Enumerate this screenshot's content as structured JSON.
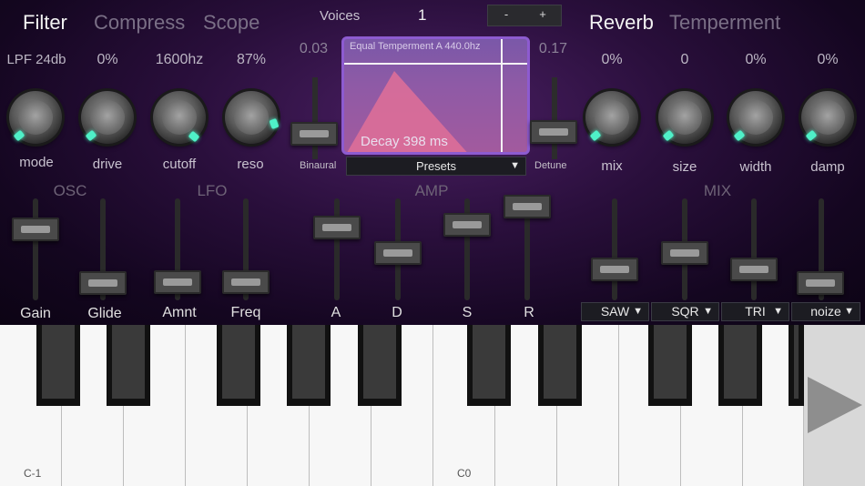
{
  "tabs_left": [
    "Filter",
    "Compress",
    "Scope"
  ],
  "tabs_right": [
    "Reverb",
    "Temperment"
  ],
  "voices": {
    "label": "Voices",
    "value": "1",
    "minus": "-",
    "plus": "+"
  },
  "filter_values": [
    "LPF 24db",
    "0%",
    "1600hz",
    "87%"
  ],
  "filter_knobs": [
    "mode",
    "drive",
    "cutoff",
    "reso"
  ],
  "reverb_values": [
    "0%",
    "0",
    "0%",
    "0%"
  ],
  "reverb_knobs": [
    "mix",
    "size",
    "width",
    "damp"
  ],
  "binaural": {
    "value": "0.03",
    "label": "Binaural"
  },
  "detune": {
    "value": "0.17",
    "label": "Detune"
  },
  "display": {
    "title": "Equal Temperment A 440.0hz",
    "decay": "Decay 398 ms"
  },
  "presets": {
    "label": "Presets",
    "arrow": "▼"
  },
  "sections": {
    "osc": "OSC",
    "lfo": "LFO",
    "amp": "AMP",
    "mix": "MIX"
  },
  "sliders_left": [
    "Gain",
    "Glide",
    "Amnt",
    "Freq"
  ],
  "sliders_amp": [
    "A",
    "D",
    "S",
    "R"
  ],
  "wave_dropdowns": [
    "SAW",
    "SQR",
    "TRI",
    "noize"
  ],
  "keyboard": {
    "labels": [
      "C-1",
      "C0"
    ]
  },
  "colors": {
    "accent": "#4ff0c8",
    "display_border": "#8d5bd0"
  },
  "icons": {
    "play": "play-triangle-icon",
    "dropdown": "chevron-down-icon"
  }
}
